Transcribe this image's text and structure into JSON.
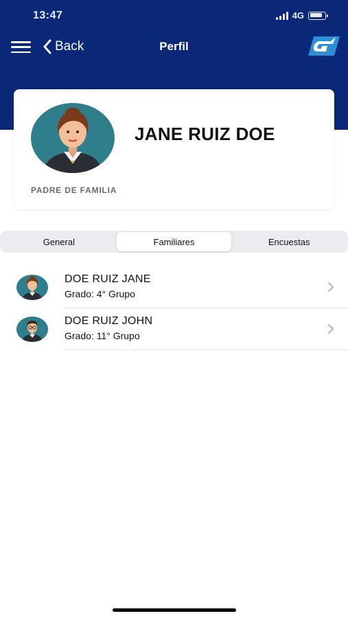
{
  "status_bar": {
    "time": "13:47",
    "network": "4G"
  },
  "nav": {
    "back_label": "Back",
    "title": "Perfil",
    "logo_icon": "app-logo-icon"
  },
  "profile": {
    "name": "JANE RUIZ DOE",
    "role": "PADRE DE FAMILIA",
    "avatar_icon": "woman-avatar-icon"
  },
  "tabs": [
    {
      "label": "General",
      "active": false
    },
    {
      "label": "Familiares",
      "active": true
    },
    {
      "label": "Encuestas",
      "active": false
    }
  ],
  "family": [
    {
      "name": "DOE RUIZ JANE",
      "grade": "Grado: 4° Grupo",
      "avatar_icon": "girl-avatar-icon"
    },
    {
      "name": "DOE RUIZ JOHN",
      "grade": "Grado: 11° Grupo",
      "avatar_icon": "boy-avatar-icon"
    }
  ],
  "colors": {
    "header": "#0a2778",
    "avatar_bg": "#2e7e8b",
    "segment_bg": "#ececf0"
  }
}
